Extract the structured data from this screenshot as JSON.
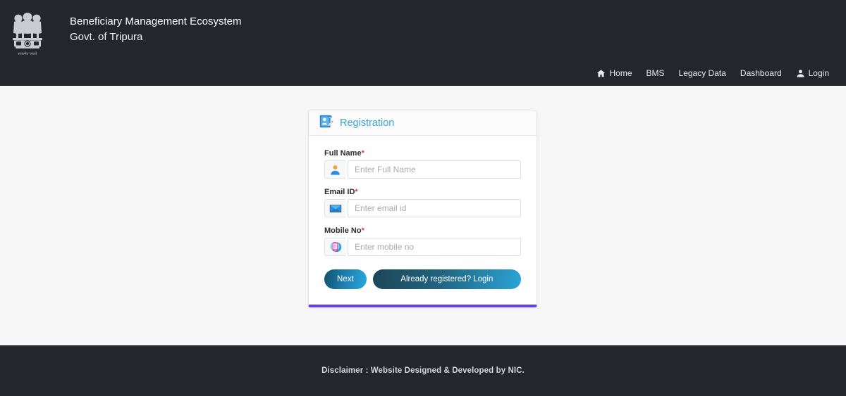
{
  "header": {
    "emblem_icon": "ashoka-pillar-emblem",
    "emblem_motto": "सत्यमेव जयते",
    "title_line1": "Beneficiary Management Ecosystem",
    "title_line2": "Govt. of Tripura"
  },
  "nav": {
    "items": [
      {
        "label": "Home",
        "icon": "home-icon"
      },
      {
        "label": "BMS",
        "icon": ""
      },
      {
        "label": "Legacy Data",
        "icon": ""
      },
      {
        "label": "Dashboard",
        "icon": ""
      },
      {
        "label": "Login",
        "icon": "user-icon"
      }
    ]
  },
  "card": {
    "icon": "registration-document-icon",
    "title": "Registration",
    "accent_color": "#6340ee",
    "title_color": "#3ba3db",
    "fields": [
      {
        "label": "Full Name",
        "required": "*",
        "placeholder": "Enter Full Name",
        "value": "",
        "icon": "user-avatar-icon"
      },
      {
        "label": "Email ID",
        "required": "*",
        "placeholder": "Enter email id",
        "value": "",
        "icon": "envelope-icon"
      },
      {
        "label": "Mobile No",
        "required": "*",
        "placeholder": "Enter mobile no",
        "value": "",
        "icon": "mobile-phone-icon"
      }
    ],
    "next_label": "Next",
    "login_label": "Already registered? Login"
  },
  "footer": {
    "text": "Disclaimer : Website Designed & Developed by NIC."
  }
}
